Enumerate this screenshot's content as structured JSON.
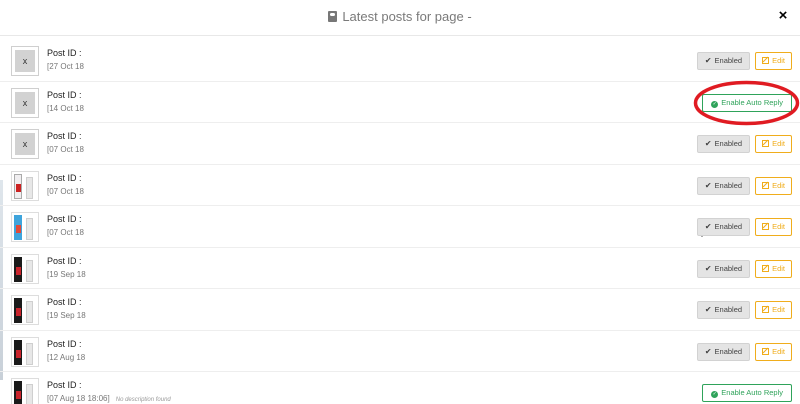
{
  "header": {
    "title": "Latest posts for page -",
    "close_label": "×"
  },
  "posts": [
    {
      "post_label": "Post ID :",
      "post_id": "",
      "date": "[27 Oct 18",
      "description": "",
      "thumb": "blank",
      "thumb_text": "x",
      "action": "enabled"
    },
    {
      "post_label": "Post ID :",
      "post_id": "",
      "date": "[14 Oct 18",
      "description": "",
      "thumb": "blank",
      "thumb_text": "x",
      "action": "auto"
    },
    {
      "post_label": "Post ID :",
      "post_id": "",
      "date": "[07 Oct 18",
      "description": "",
      "thumb": "blank",
      "thumb_text": "x",
      "action": "enabled"
    },
    {
      "post_label": "Post ID :",
      "post_id": "",
      "date": "[07 Oct 18",
      "description": "",
      "thumb": "photo-light",
      "thumb_text": "",
      "action": "enabled"
    },
    {
      "post_label": "Post ID :",
      "post_id": "",
      "date": "[07 Oct 18",
      "description": "",
      "thumb": "photo-blue",
      "thumb_text": "",
      "action": "enabled"
    },
    {
      "post_label": "Post ID :",
      "post_id": "",
      "date": "[19 Sep 18",
      "description": "",
      "thumb": "photo",
      "thumb_text": "",
      "action": "enabled"
    },
    {
      "post_label": "Post ID :",
      "post_id": "",
      "date": "[19 Sep 18",
      "description": "",
      "thumb": "photo",
      "thumb_text": "",
      "action": "enabled"
    },
    {
      "post_label": "Post ID :",
      "post_id": "",
      "date": "[12 Aug 18",
      "description": "",
      "thumb": "photo",
      "thumb_text": "",
      "action": "enabled"
    },
    {
      "post_label": "Post ID :",
      "post_id": "",
      "date": "[07 Aug 18 18:06]",
      "description": "No description found",
      "thumb": "photo",
      "thumb_text": "",
      "action": "auto"
    }
  ],
  "actions": {
    "enabled_label": "Enabled",
    "edit_label": "Edit",
    "auto_reply_label": "Enable Auto Reply"
  },
  "icons": {
    "title": "user-icon",
    "close": "close-icon",
    "enabled": "check-icon",
    "edit": "edit-icon",
    "auto_reply": "check-circle-icon"
  },
  "colors": {
    "edit_accent": "#f0ad1c",
    "auto_reply_accent": "#2fa35a",
    "annotation": "#e01b22",
    "post_id_link": "#1f76c9"
  }
}
